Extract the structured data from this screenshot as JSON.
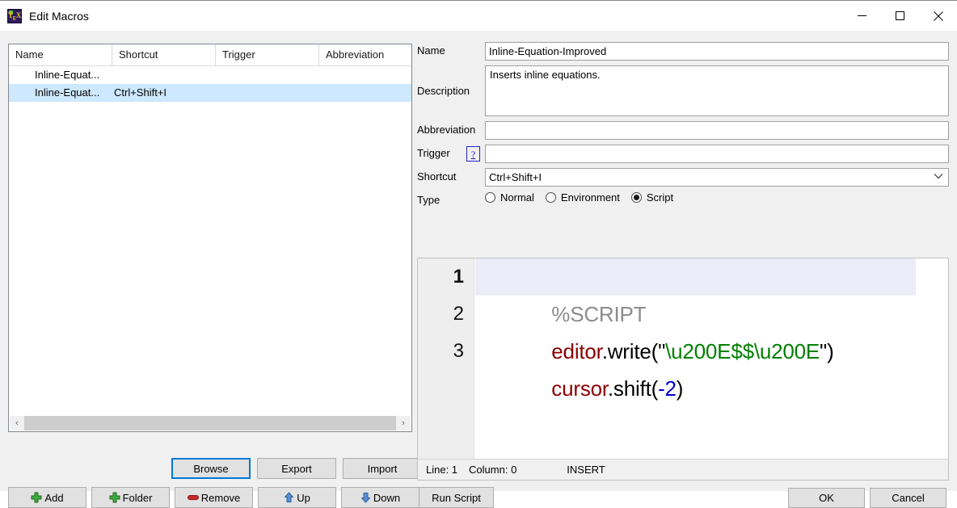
{
  "window": {
    "title": "Edit Macros",
    "app_icon": "texstudio-icon",
    "controls": [
      {
        "name": "minimize-button",
        "glyph": "minimize-icon"
      },
      {
        "name": "maximize-button",
        "glyph": "maximize-icon"
      },
      {
        "name": "close-button",
        "glyph": "close-icon"
      }
    ]
  },
  "macro_list": {
    "columns": [
      "Name",
      "Shortcut",
      "Trigger",
      "Abbreviation"
    ],
    "rows": [
      {
        "name": "Inline-Equat...",
        "shortcut": "",
        "trigger": "",
        "abbreviation": "",
        "selected": false
      },
      {
        "name": "Inline-Equat...",
        "shortcut": "Ctrl+Shift+I",
        "trigger": "",
        "abbreviation": "",
        "selected": true
      }
    ],
    "hscroll": {
      "left_arrow": "‹",
      "right_arrow": "›"
    }
  },
  "list_buttons": {
    "browse": "Browse",
    "export": "Export",
    "import": "Import",
    "add": "Add",
    "folder": "Folder",
    "remove": "Remove",
    "up": "Up",
    "down": "Down"
  },
  "form": {
    "name_label": "Name",
    "name_value": "Inline-Equation-Improved",
    "name_placeholder": "",
    "description_label": "Description",
    "description_value": "Inserts inline equations.",
    "description_placeholder": "",
    "abbreviation_label": "Abbreviation",
    "abbreviation_value": "",
    "abbreviation_placeholder": "",
    "trigger_label": "Trigger",
    "trigger_help": "?",
    "trigger_value": "",
    "trigger_placeholder": "",
    "shortcut_label": "Shortcut",
    "shortcut_value": "Ctrl+Shift+I",
    "shortcut_options": [
      "Ctrl+Shift+I"
    ],
    "shortcut_chevron": "⌄",
    "type_label": "Type",
    "type_options": [
      {
        "label": "Normal",
        "checked": false
      },
      {
        "label": "Environment",
        "checked": false
      },
      {
        "label": "Script",
        "checked": true
      }
    ]
  },
  "editor": {
    "lines": [
      {
        "number": "1",
        "current": true,
        "tokens": [
          {
            "t": "%SCRIPT",
            "k": "comment"
          }
        ]
      },
      {
        "number": "2",
        "current": false,
        "tokens": [
          {
            "t": "editor",
            "k": "ident"
          },
          {
            "t": ".write(\"",
            "k": "plain"
          },
          {
            "t": "\\u200E$$\\u200E",
            "k": "string"
          },
          {
            "t": "\")",
            "k": "plain"
          }
        ]
      },
      {
        "number": "3",
        "current": false,
        "tokens": [
          {
            "t": "cursor",
            "k": "ident"
          },
          {
            "t": ".shift(",
            "k": "plain"
          },
          {
            "t": "-2",
            "k": "number"
          },
          {
            "t": ")",
            "k": "plain"
          }
        ]
      }
    ],
    "status": {
      "line": "Line: 1",
      "column": "Column: 0",
      "mode": "INSERT"
    }
  },
  "actions": {
    "run_script": "Run Script",
    "ok": "OK",
    "cancel": "Cancel"
  },
  "colors": {
    "selection": "#cde8ff",
    "current_line": "#ececf8",
    "accent": "#0078d7",
    "comment": "#8c8c8c",
    "identifier": "#8b0000",
    "string": "#008000",
    "number": "#0000cc"
  }
}
